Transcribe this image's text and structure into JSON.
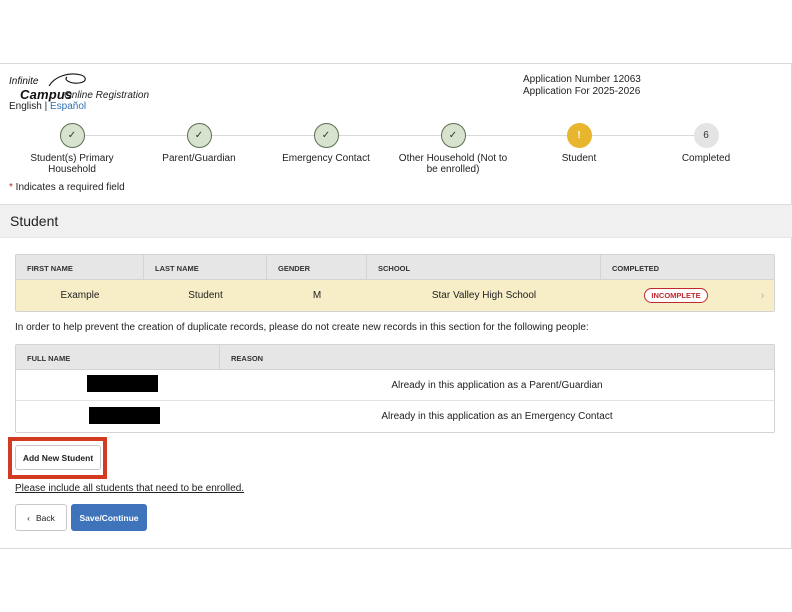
{
  "logo": {
    "line1": "Infinite",
    "line2": "Campus",
    "subtitle": "Online Registration"
  },
  "lang": {
    "english": "English",
    "sep": "|",
    "spanish": "Español"
  },
  "app": {
    "number": "Application Number 12063",
    "year": "Application For 2025-2026"
  },
  "steps": [
    {
      "label": "Student(s) Primary Household",
      "marker": "✓",
      "state": "done"
    },
    {
      "label": "Parent/Guardian",
      "marker": "✓",
      "state": "done"
    },
    {
      "label": "Emergency Contact",
      "marker": "✓",
      "state": "done"
    },
    {
      "label": "Other Household (Not to be enrolled)",
      "marker": "✓",
      "state": "done"
    },
    {
      "label": "Student",
      "marker": "!",
      "state": "warning"
    },
    {
      "label": "Completed",
      "marker": "6",
      "state": "pending"
    }
  ],
  "required_note": {
    "star": "*",
    "text": " Indicates a required field"
  },
  "section_title": "Student",
  "students_table": {
    "headers": [
      "FIRST NAME",
      "LAST NAME",
      "GENDER",
      "SCHOOL",
      "COMPLETED"
    ],
    "row": {
      "first": "Example",
      "last": "Student",
      "gender": "M",
      "school": "Star Valley High School",
      "status": "INCOMPLETE"
    }
  },
  "duplicate_notice": "In order to help prevent the creation of duplicate records, please do not create new records in this section for the following people:",
  "dupes_table": {
    "headers": [
      "FULL NAME",
      "REASON"
    ],
    "rows": [
      {
        "reason": "Already in this application as a Parent/Guardian"
      },
      {
        "reason": "Already in this application as an Emergency Contact"
      }
    ]
  },
  "buttons": {
    "add_student": "Add New Student",
    "back": "Back",
    "save": "Save/Continue"
  },
  "include_note": "Please include all students that need to be enrolled.",
  "colors": {
    "accent": "#3f74bd",
    "warning": "#e8b52f",
    "error": "#c0282e",
    "highlight": "#d33a22",
    "student_row": "#f7edc6"
  }
}
